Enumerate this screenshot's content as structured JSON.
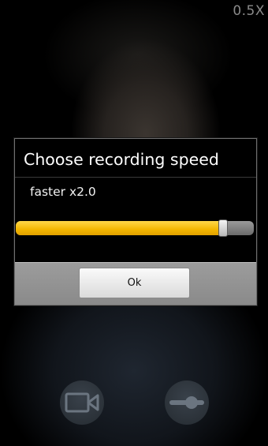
{
  "camera": {
    "zoom_label": "0.5X"
  },
  "dialog": {
    "title": "Choose recording speed",
    "speed_value": "faster x2.0",
    "slider_fraction": 0.87,
    "ok_label": "Ok"
  },
  "controls": {
    "video_button_icon": "video-camera-icon",
    "speed_button_icon": "slider-icon"
  },
  "colors": {
    "accent": "#f3b600",
    "dialog_background": "#000000",
    "footer_background": "#999999"
  }
}
